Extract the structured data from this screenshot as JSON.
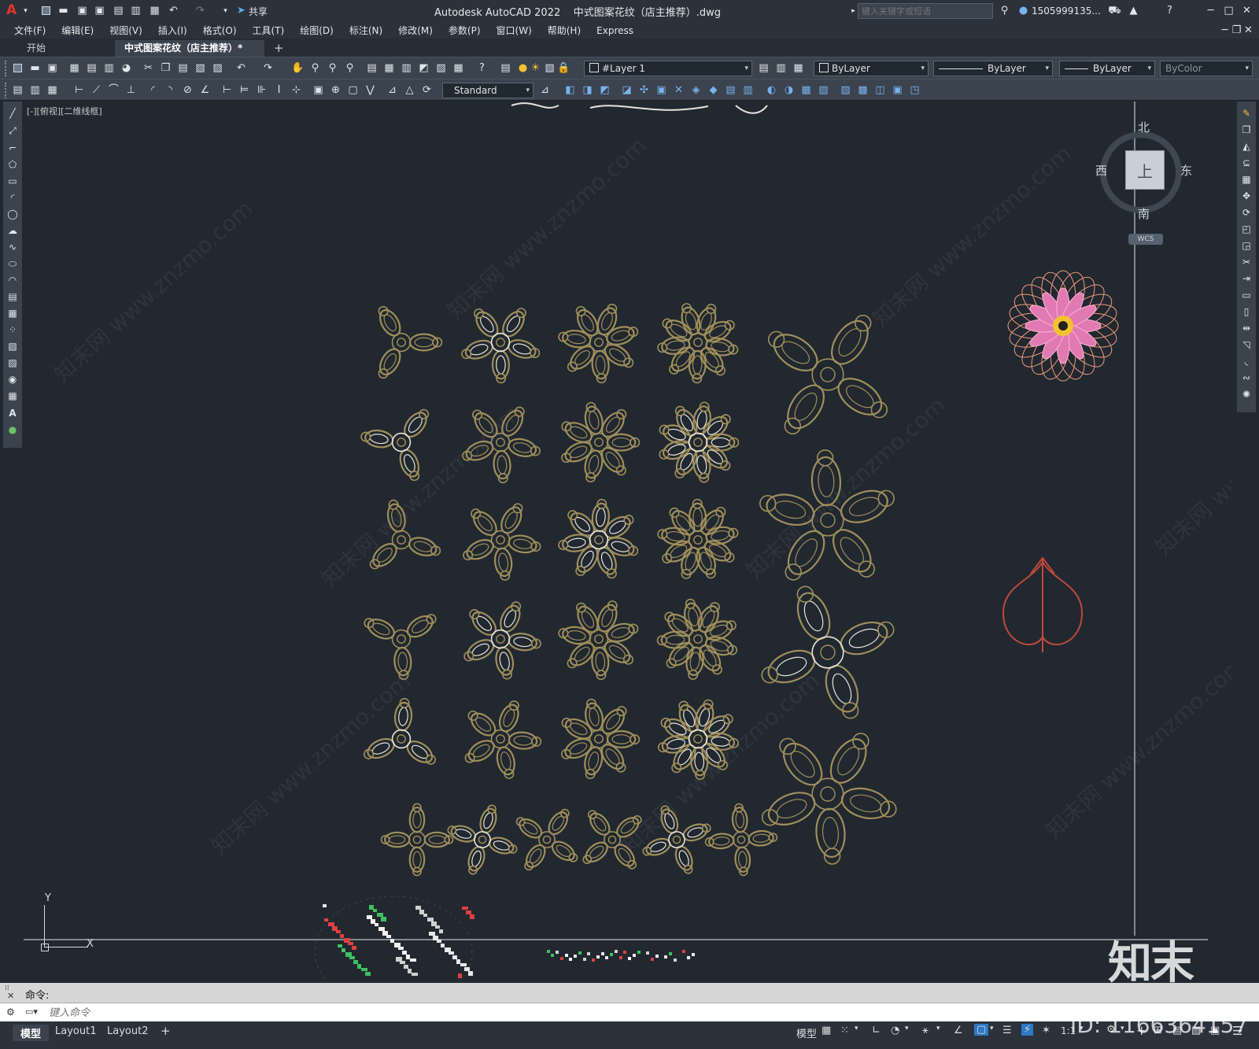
{
  "app": {
    "title": "Autodesk AutoCAD 2022",
    "document": "中式图案花纹（店主推荐）.dwg",
    "share_label": "共享",
    "search_placeholder": "键入关键字或短语",
    "user": "1505999135...",
    "logo": "A"
  },
  "menu": [
    "文件(F)",
    "编辑(E)",
    "视图(V)",
    "插入(I)",
    "格式(O)",
    "工具(T)",
    "绘图(D)",
    "标注(N)",
    "修改(M)",
    "参数(P)",
    "窗口(W)",
    "帮助(H)",
    "Express"
  ],
  "tabs": [
    {
      "label": "开始",
      "active": false
    },
    {
      "label": "中式图案花纹（店主推荐）*",
      "active": true
    }
  ],
  "toolbar": {
    "layer": "#Layer 1",
    "color": "ByLayer",
    "linetype": "ByLayer",
    "lineweight": "ByLayer",
    "plotstyle": "ByColor",
    "textstyle": "Standard"
  },
  "viewport": {
    "label": "[-][俯视][二维线框]",
    "viewcube": {
      "n": "北",
      "s": "南",
      "e": "东",
      "w": "西",
      "face": "上",
      "wcs": "WCS"
    },
    "ucs": {
      "x": "X",
      "y": "Y"
    },
    "pattern_color": "#a08f5b",
    "highlight_color": "#e8e4d8",
    "accent_red": "#c0493c"
  },
  "command": {
    "history": "命令:",
    "placeholder": "键入命令"
  },
  "layout_tabs": [
    "模型",
    "Layout1",
    "Layout2"
  ],
  "status": {
    "model": "模型",
    "scale": "1:1"
  },
  "overlay": {
    "brand": "知末",
    "id": "ID: 1166364157",
    "watermark": "知末网 www.znzmo.com"
  }
}
